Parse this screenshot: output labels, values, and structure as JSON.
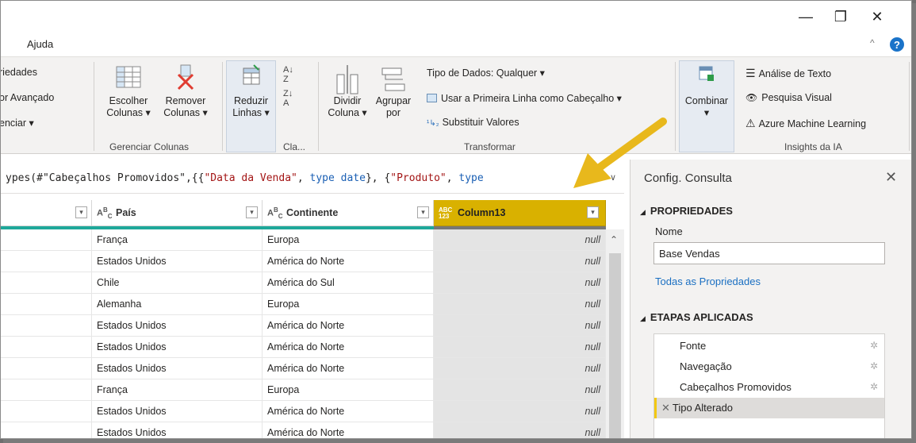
{
  "window": {
    "minimize": "—",
    "restore": "❐",
    "close": "✕"
  },
  "menu": {
    "ajuda": "Ajuda",
    "collapse": "^",
    "help": "?"
  },
  "ribbon": {
    "left_items": [
      "riedades",
      "or Avançado",
      "enciar ▾"
    ],
    "escolher": "Escolher\nColunas ▾",
    "remover": "Remover\nColunas ▾",
    "gerenciar_colunas": "Gerenciar Colunas",
    "reduzir": "Reduzir\nLinhas ▾",
    "classificar": "Cla...",
    "dividir": "Dividir\nColuna ▾",
    "agrupar": "Agrupar\npor",
    "tipo_dados": "Tipo de Dados: Qualquer ▾",
    "usar_primeira": "Usar a Primeira Linha como Cabeçalho ▾",
    "substituir": "Substituir Valores",
    "transformar": "Transformar",
    "combinar": "Combinar",
    "combinar_arrow": "▾",
    "analise_texto": "Análise de Texto",
    "pesquisa_visual": "Pesquisa Visual",
    "azure_ml": "Azure Machine Learning",
    "insights": "Insights da IA"
  },
  "formula": {
    "p1": "ypes(#\"Cabeçalhos Promovidos\",{{",
    "s1": "\"Data da Venda\"",
    "p2": ", ",
    "k1": "type date",
    "p3": "}, {",
    "s2": "\"Produto\"",
    "p4": ", ",
    "k2": "type"
  },
  "grid": {
    "col_pais": "País",
    "col_continente": "Continente",
    "col13": "Column13",
    "type_abc": "ABC",
    "type_any": "ABC\n123",
    "dd": "▾",
    "null": "null",
    "rows": [
      [
        "França",
        "Europa"
      ],
      [
        "Estados Unidos",
        "América do Norte"
      ],
      [
        "Chile",
        "América do Sul"
      ],
      [
        "Alemanha",
        "Europa"
      ],
      [
        "Estados Unidos",
        "América do Norte"
      ],
      [
        "Estados Unidos",
        "América do Norte"
      ],
      [
        "Estados Unidos",
        "América do Norte"
      ],
      [
        "França",
        "Europa"
      ],
      [
        "Estados Unidos",
        "América do Norte"
      ],
      [
        "Estados Unidos",
        "América do Norte"
      ]
    ]
  },
  "pane": {
    "title": "Config. Consulta",
    "close": "✕",
    "propriedades": "PROPRIEDADES",
    "nome": "Nome",
    "nome_value": "Base Vendas",
    "todas": "Todas as Propriedades",
    "etapas": "ETAPAS APLICADAS",
    "steps": [
      "Fonte",
      "Navegação",
      "Cabeçalhos Promovidos",
      "Tipo Alterado"
    ]
  },
  "colors": {
    "accent_yellow": "#f2c811",
    "teal": "#1ea89a",
    "link": "#1a6fc2",
    "column_header_selected": "#d9b100"
  }
}
